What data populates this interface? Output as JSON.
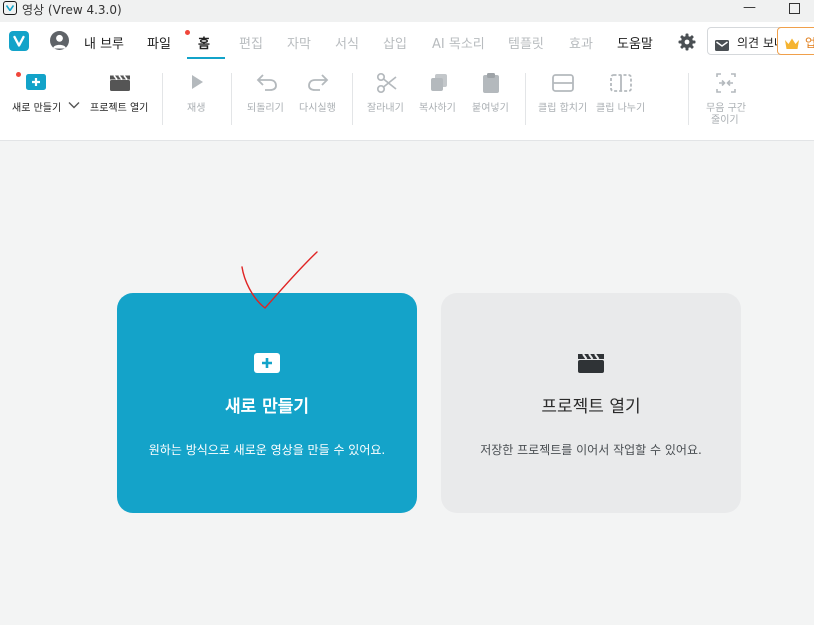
{
  "window": {
    "title": "영상 (Vrew 4.3.0)",
    "minimize_glyph": "—"
  },
  "menubar": {
    "items": [
      {
        "label": "내 브루",
        "state": "normal"
      },
      {
        "label": "파일",
        "state": "normal"
      },
      {
        "label": "홈",
        "state": "active"
      },
      {
        "label": "편집",
        "state": "disabled"
      },
      {
        "label": "자막",
        "state": "disabled"
      },
      {
        "label": "서식",
        "state": "disabled"
      },
      {
        "label": "삽입",
        "state": "disabled"
      },
      {
        "label": "AI 목소리",
        "state": "disabled"
      },
      {
        "label": "템플릿",
        "state": "disabled"
      },
      {
        "label": "효과",
        "state": "disabled"
      },
      {
        "label": "도움말",
        "state": "normal"
      }
    ],
    "feedback_label": "의견 보내",
    "upgrade_label": "업"
  },
  "toolbar": {
    "new_project": "새로 만들기",
    "open_project": "프로젝트 열기",
    "play": "재생",
    "undo": "되돌리기",
    "redo": "다시실행",
    "cut": "잘라내기",
    "copy": "복사하기",
    "paste": "붙여넣기",
    "merge_clips": "클립 합치기",
    "split_clip": "클립 나누기",
    "shorten_silence_line1": "무음 구간",
    "shorten_silence_line2": "줄이기"
  },
  "cards": {
    "new": {
      "title": "새로 만들기",
      "description": "원하는 방식으로 새로운 영상을 만들 수 있어요."
    },
    "open": {
      "title": "프로젝트 열기",
      "description": "저장한 프로젝트를 이어서 작업할 수 있어요."
    }
  },
  "colors": {
    "accent": "#14a3c9",
    "notification_dot": "#f0463a",
    "upgrade": "#e07b16",
    "annotation": "#e02424"
  },
  "icons": [
    "vrew-logo-icon",
    "profile-icon",
    "gear-icon",
    "mail-icon",
    "crown-icon",
    "add-icon",
    "clapperboard-icon",
    "play-icon",
    "undo-icon",
    "redo-icon",
    "scissors-icon",
    "copy-icon",
    "clipboard-icon",
    "merge-clips-icon",
    "split-clip-icon",
    "shorten-silence-icon"
  ]
}
